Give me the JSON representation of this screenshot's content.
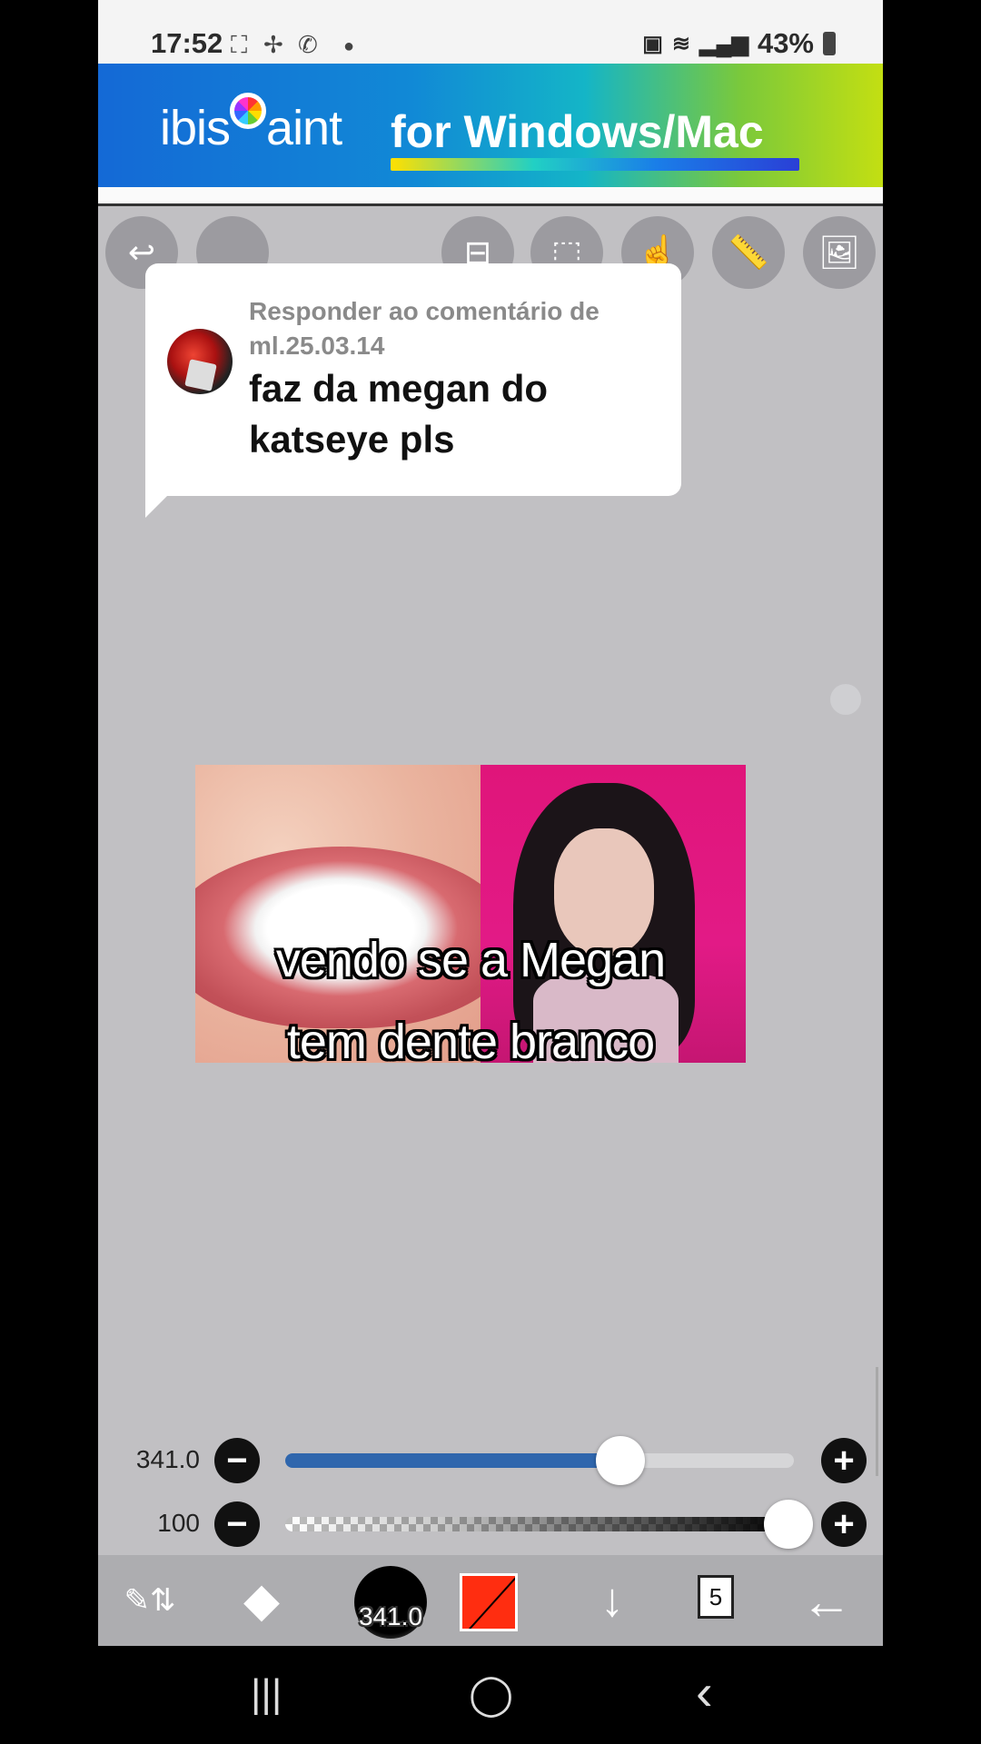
{
  "status_bar": {
    "time": "17:52",
    "left_icons": [
      "screenshot-icon",
      "pinwheel-icon",
      "whatsapp-icon",
      "dot-icon"
    ],
    "right_icons": [
      "battery-saver-icon",
      "wifi-icon",
      "signal-icon"
    ],
    "battery": "43%"
  },
  "banner": {
    "logo_prefix": "ibis",
    "logo_suffix": "aint",
    "slogan": "for Windows/Mac"
  },
  "top_toolbar": {
    "buttons": [
      "undo-icon",
      "blank-icon",
      "toggle-icon",
      "selection-icon",
      "hand-icon",
      "ruler-icon",
      "image-icon"
    ]
  },
  "comment": {
    "reply_label": "Responder ao comentário de ml.25.03.14",
    "text": "faz da megan do katseye pls"
  },
  "meme": {
    "caption_line1": "vendo se a Megan",
    "caption_line2": "tem dente branco"
  },
  "sliders": {
    "size": {
      "label": "341.0",
      "fraction": 0.67
    },
    "opacity": {
      "label": "100",
      "fraction": 1.0
    },
    "minus": "−",
    "plus": "+"
  },
  "bottom_toolbar": {
    "brush_size": "341.0",
    "color": "#ff2d10",
    "layer_count": "5"
  },
  "nav_bar": {
    "recents": "|||",
    "home": "◯",
    "back": "‹"
  }
}
